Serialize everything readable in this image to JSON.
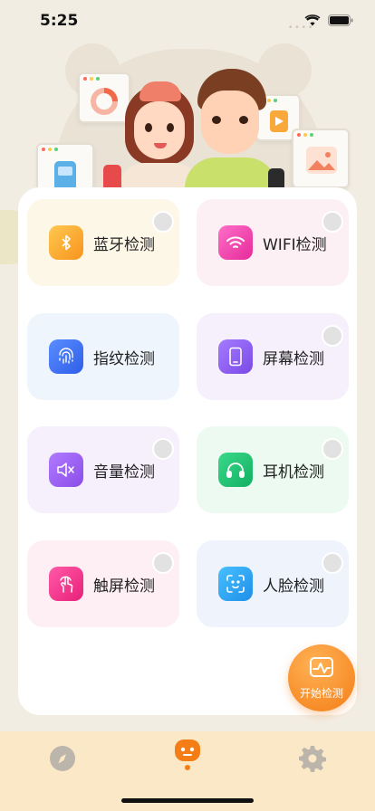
{
  "status_bar": {
    "time": "5:25"
  },
  "detections": [
    {
      "label": "蓝牙检测",
      "icon": "bluetooth-icon",
      "tile_bg": "#fdf7e8",
      "icon_grad": [
        "#ffc850",
        "#f7941d"
      ]
    },
    {
      "label": "WIFI检测",
      "icon": "wifi-icon",
      "tile_bg": "#fdf0f4",
      "icon_grad": [
        "#ff6fc8",
        "#e52a9a"
      ]
    },
    {
      "label": "指纹检测",
      "icon": "fingerprint-icon",
      "tile_bg": "#eef5fc",
      "icon_grad": [
        "#5a8dff",
        "#2f5ee8"
      ]
    },
    {
      "label": "屏幕检测",
      "icon": "phone-screen-icon",
      "tile_bg": "#f6f0fc",
      "icon_grad": [
        "#a57bff",
        "#7a4ae6"
      ]
    },
    {
      "label": "音量检测",
      "icon": "volume-mute-icon",
      "tile_bg": "#f6effc",
      "icon_grad": [
        "#b07bff",
        "#8a4de8"
      ]
    },
    {
      "label": "耳机检测",
      "icon": "headphones-icon",
      "tile_bg": "#ecfaf1",
      "icon_grad": [
        "#3ad98a",
        "#12b062"
      ]
    },
    {
      "label": "触屏检测",
      "icon": "touch-icon",
      "tile_bg": "#fdeff4",
      "icon_grad": [
        "#ff5aa8",
        "#e8207a"
      ]
    },
    {
      "label": "人脸检测",
      "icon": "face-scan-icon",
      "tile_bg": "#eef3fc",
      "icon_grad": [
        "#47c0ff",
        "#1f8fe8"
      ]
    }
  ],
  "start_button": {
    "label": "开始检测"
  },
  "bottom_nav": {
    "items": [
      {
        "icon": "compass-icon",
        "active": false
      },
      {
        "icon": "robot-face-icon",
        "active": true
      },
      {
        "icon": "gear-icon",
        "active": false
      }
    ]
  },
  "colors": {
    "accent": "#f47d16",
    "nav_bg": "#fbe8c6",
    "page_bg": "#f2ede3"
  }
}
